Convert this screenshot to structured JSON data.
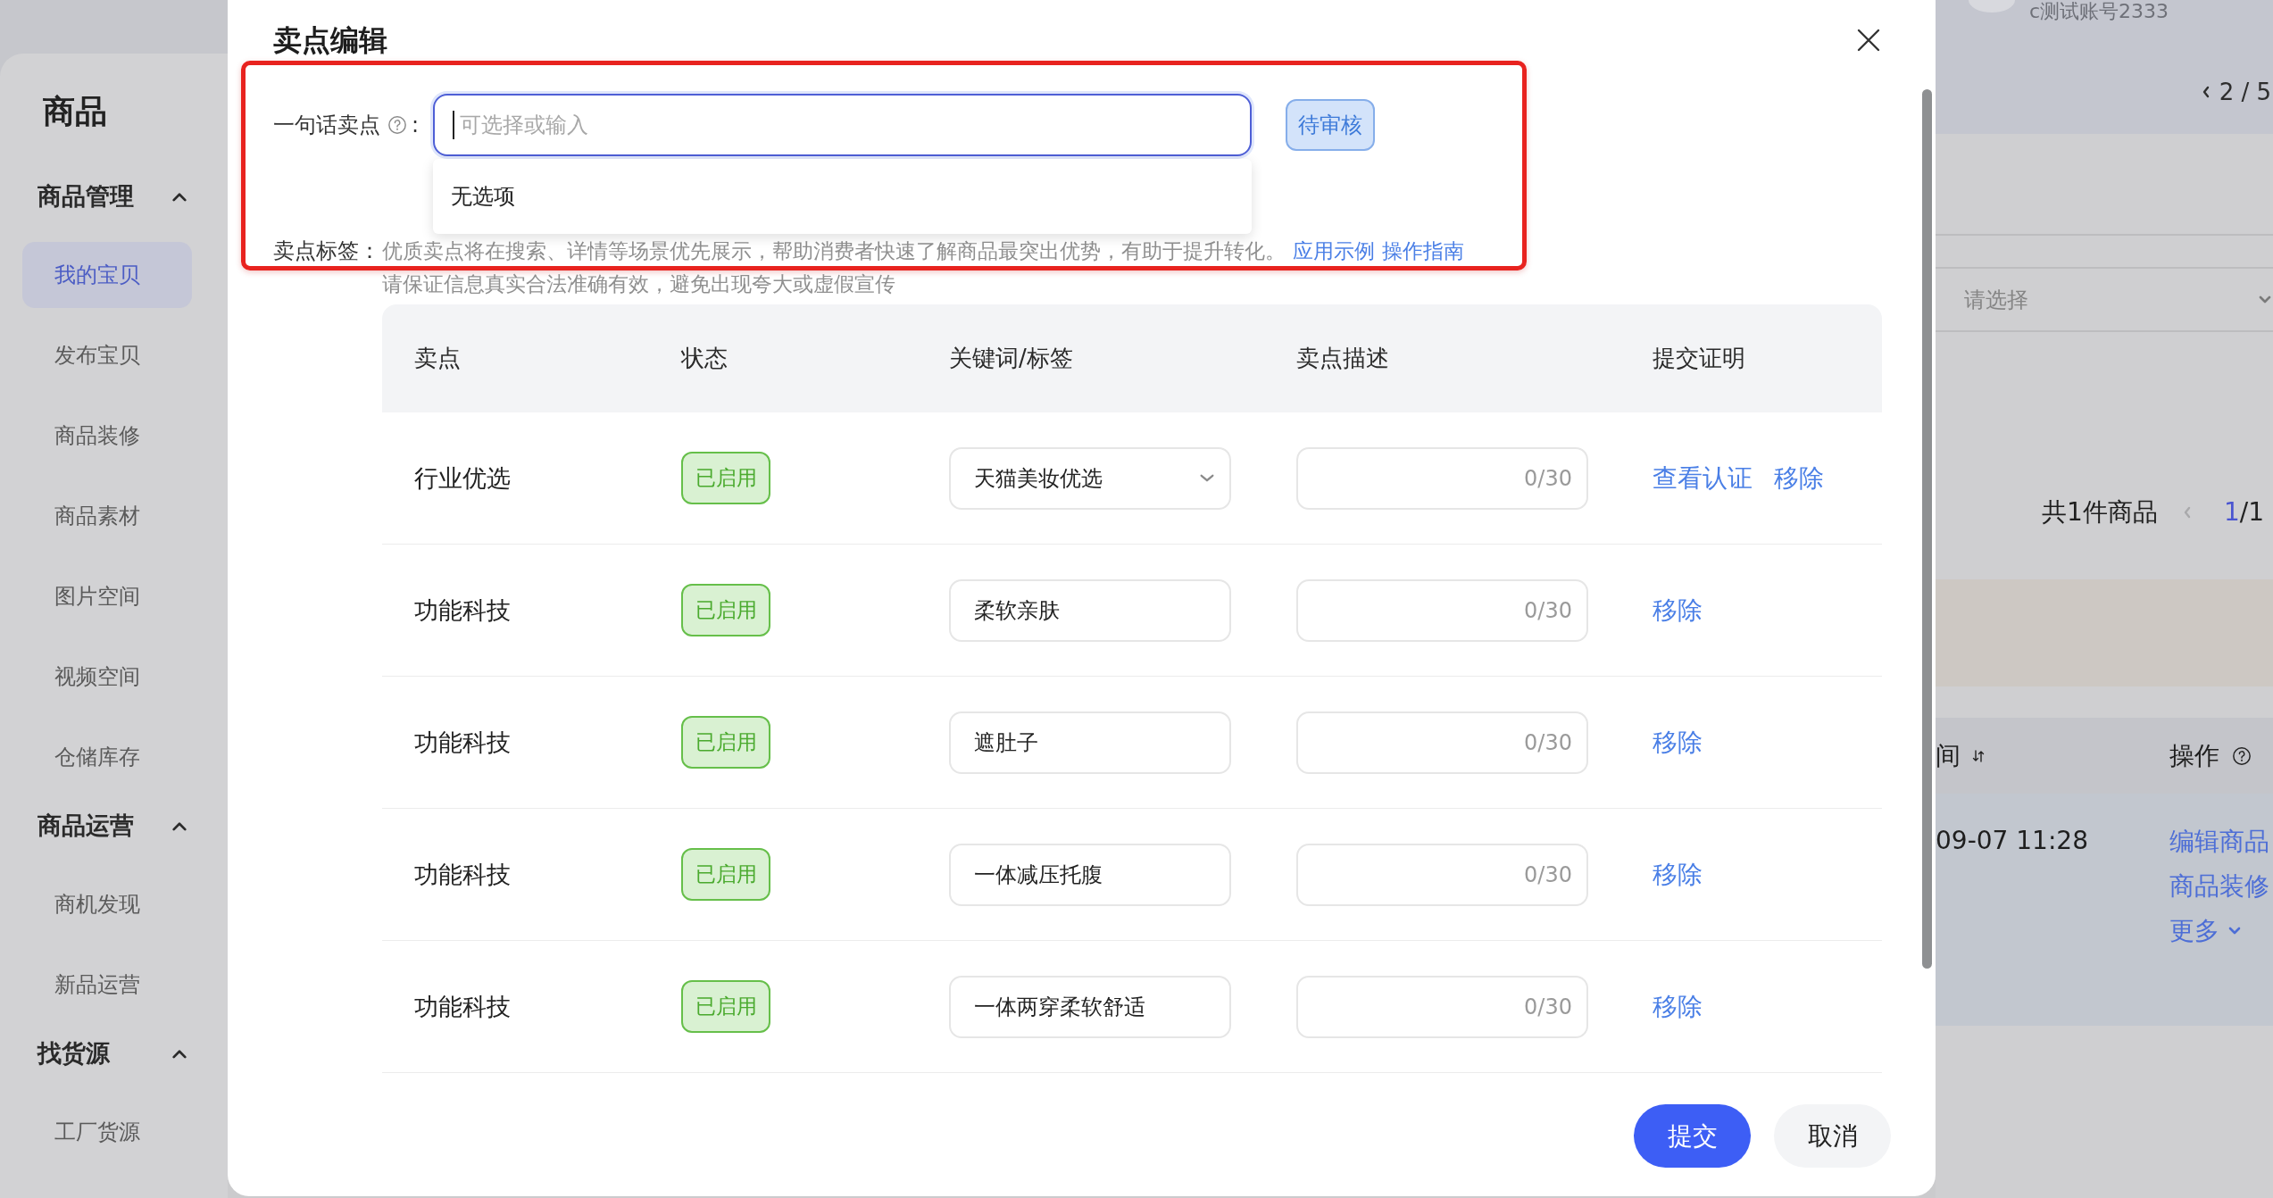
{
  "page": {
    "account": {
      "name": "c测试账号2333"
    },
    "sidebar": {
      "title": "商品",
      "groups": [
        {
          "label": "商品管理",
          "expanded": true,
          "items": [
            {
              "label": "我的宝贝",
              "selected": true
            },
            {
              "label": "发布宝贝",
              "selected": false
            },
            {
              "label": "商品装修",
              "selected": false
            },
            {
              "label": "商品素材",
              "selected": false
            },
            {
              "label": "图片空间",
              "selected": false
            },
            {
              "label": "视频空间",
              "selected": false
            },
            {
              "label": "仓储库存",
              "selected": false
            }
          ]
        },
        {
          "label": "商品运营",
          "expanded": true,
          "items": [
            {
              "label": "商机发现",
              "selected": false
            },
            {
              "label": "新品运营",
              "selected": false
            }
          ]
        },
        {
          "label": "找货源",
          "expanded": true,
          "items": [
            {
              "label": "工厂货源",
              "selected": false
            }
          ]
        }
      ]
    },
    "top_pager": {
      "text": "2 / 5"
    },
    "filter": {
      "placeholder": "请选择"
    },
    "summary": {
      "count": "共1件商品",
      "current_page": "1",
      "page_total": "/1"
    },
    "table": {
      "columns": [
        {
          "label": "间",
          "kind": "sortable"
        },
        {
          "label": "操作",
          "kind": "help"
        }
      ],
      "rows": [
        {
          "column_1": "09-07 11:28",
          "actions": [
            "编辑商品",
            "商品装修"
          ],
          "more": "更多"
        }
      ]
    }
  },
  "dialog": {
    "title": "卖点编辑",
    "highlighted": true,
    "slogan": {
      "label": "一句话卖点",
      "suffix": ":",
      "placeholder": "可选择或输入",
      "focused": true,
      "status": "待审核",
      "dropdown": {
        "open": true,
        "empty_text": "无选项"
      }
    },
    "tags": {
      "label": "卖点标签：",
      "hint": "优质卖点将在搜索、详情等场景优先展示，帮助消费者快速了解商品最突出优势，有助于提升转化。",
      "links": [
        "应用示例",
        "操作指南"
      ],
      "note": "请保证信息真实合法准确有效，避免出现夸大或虚假宣传"
    },
    "table": {
      "columns": [
        "卖点",
        "状态",
        "关键词/标签",
        "卖点描述",
        "提交证明"
      ],
      "rows": [
        {
          "selling_point": "行业优选",
          "status": "已启用",
          "enabled": true,
          "keyword": {
            "kind": "select",
            "value": "天猫美妆优选"
          },
          "description": {
            "counter": "0/30"
          },
          "actions": [
            "查看认证",
            "移除"
          ]
        },
        {
          "selling_point": "功能科技",
          "status": "已启用",
          "enabled": true,
          "keyword": {
            "kind": "input",
            "value": "柔软亲肤"
          },
          "description": {
            "counter": "0/30"
          },
          "actions": [
            "移除"
          ]
        },
        {
          "selling_point": "功能科技",
          "status": "已启用",
          "enabled": true,
          "keyword": {
            "kind": "input",
            "value": "遮肚子"
          },
          "description": {
            "counter": "0/30"
          },
          "actions": [
            "移除"
          ]
        },
        {
          "selling_point": "功能科技",
          "status": "已启用",
          "enabled": true,
          "keyword": {
            "kind": "input",
            "value": "一体减压托腹"
          },
          "description": {
            "counter": "0/30"
          },
          "actions": [
            "移除"
          ]
        },
        {
          "selling_point": "功能科技",
          "status": "已启用",
          "enabled": true,
          "keyword": {
            "kind": "input",
            "value": "一体两穿柔软舒适"
          },
          "description": {
            "counter": "0/30"
          },
          "actions": [
            "移除"
          ]
        }
      ]
    },
    "buttons": [
      {
        "label": "提交",
        "kind": "primary"
      },
      {
        "label": "取消",
        "kind": "secondary"
      }
    ]
  }
}
